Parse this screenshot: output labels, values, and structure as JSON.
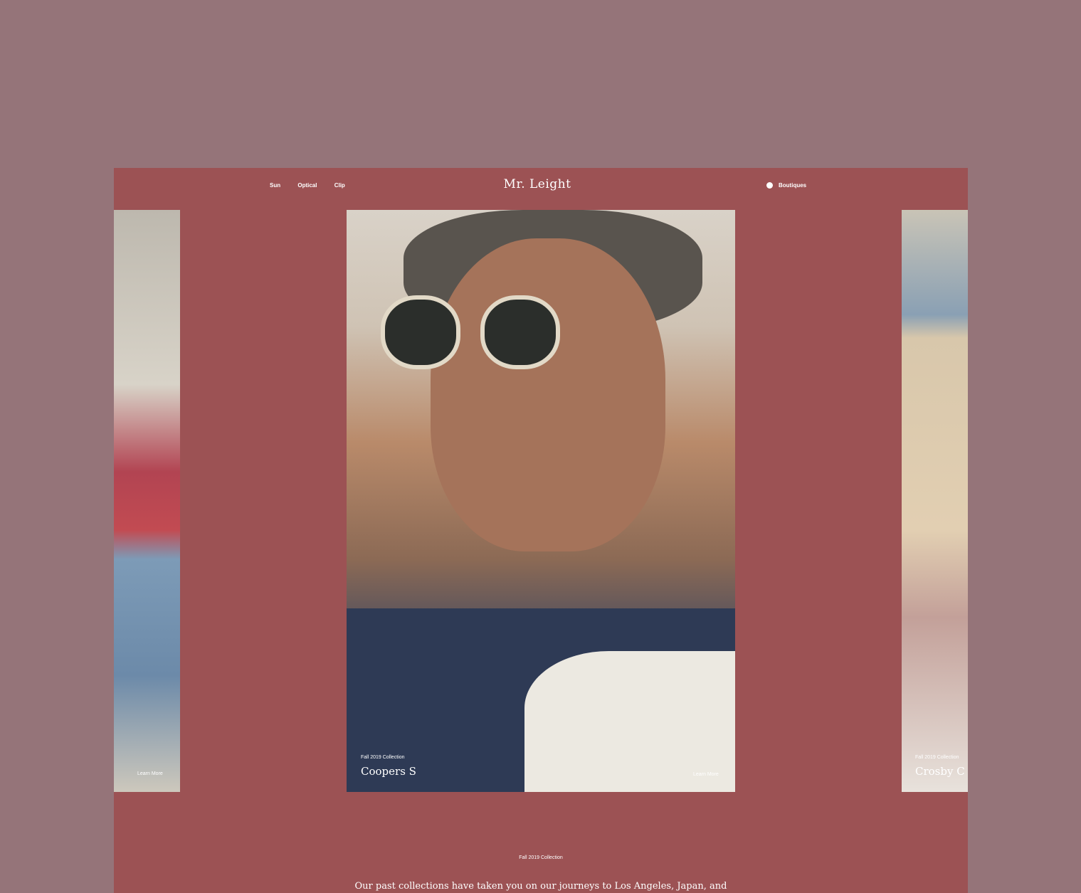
{
  "site": {
    "logo": "Mr. Leight"
  },
  "nav": {
    "sun": "Sun",
    "optical": "Optical",
    "clip": "Clip",
    "boutiques": "Boutiques"
  },
  "carousel": {
    "left": {
      "learn_more": "Learn More"
    },
    "main": {
      "collection": "Fall 2019 Collection",
      "title": "Coopers S",
      "learn_more": "Learn More"
    },
    "right": {
      "collection": "Fall 2019 Collection",
      "title": "Crosby C"
    }
  },
  "section": {
    "label": "Fall 2019 Collection",
    "text": "Our past collections have taken you on our journeys to Los Angeles, Japan, and"
  },
  "colors": {
    "outer_bg": "#957479",
    "frame_bg": "#9c5254",
    "text": "#ffffff"
  }
}
